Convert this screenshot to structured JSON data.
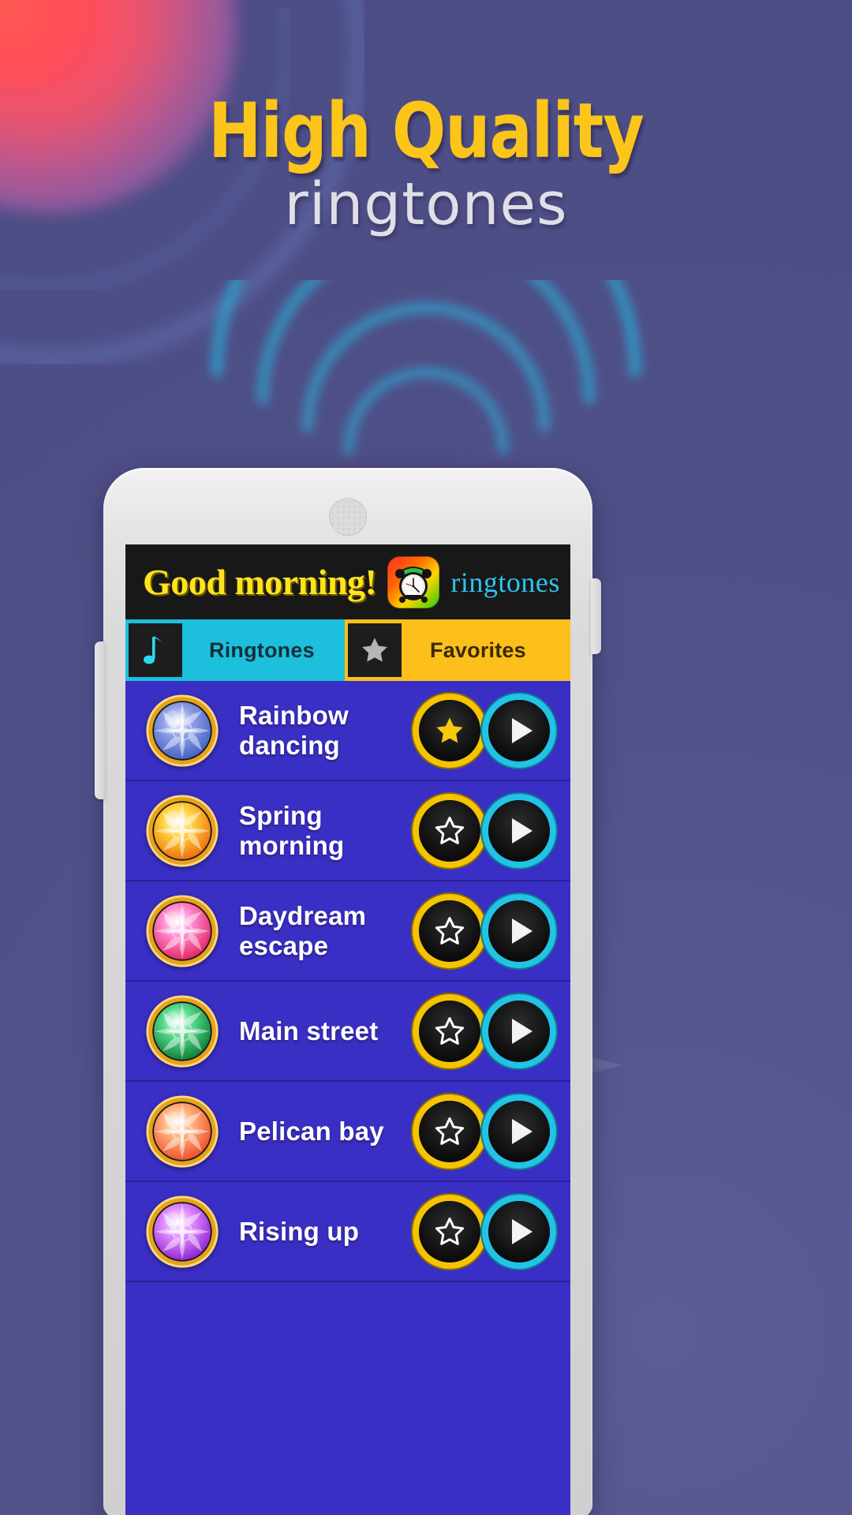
{
  "promo": {
    "headline": "High Quality",
    "subheadline": "ringtones",
    "headline_color": "#fcc51a",
    "subheadline_color": "#dfdfe6",
    "background_color": "#56568d",
    "accent_glow_color": "#ff4d4d",
    "arc_color": "#2f9fc9"
  },
  "app": {
    "banner": {
      "title": "Good morning!",
      "brand": "ringtones",
      "title_color": "#ffe31c",
      "brand_color": "#2fc3ef",
      "background_color": "#181818",
      "icon": "alarm-clock-icon"
    },
    "tabs": [
      {
        "label": "Ringtones",
        "icon": "music-note-icon",
        "active": true,
        "color": "#1cc0dd"
      },
      {
        "label": "Favorites",
        "icon": "star-icon",
        "active": false,
        "color": "#fcbf1b"
      }
    ],
    "list": {
      "row_color": "#3a2fc4",
      "favorite_button_ring": "#f5c400",
      "play_button_ring": "#22c3e4",
      "items": [
        {
          "title": "Rainbow dancing",
          "favorite": true,
          "thumb": "sun-icon-blue",
          "thumb_color": "#7f8fe0"
        },
        {
          "title": "Spring morning",
          "favorite": false,
          "thumb": "sun-icon-orange",
          "thumb_color": "#f7a21a"
        },
        {
          "title": "Daydream escape",
          "favorite": false,
          "thumb": "sun-icon-pink",
          "thumb_color": "#ef4aa0"
        },
        {
          "title": "Main street",
          "favorite": false,
          "thumb": "sun-icon-green",
          "thumb_color": "#1fa54d"
        },
        {
          "title": "Pelican bay",
          "favorite": false,
          "thumb": "sun-icon-coral",
          "thumb_color": "#f4633b"
        },
        {
          "title": "Rising up",
          "favorite": false,
          "thumb": "sun-icon-violet",
          "thumb_color": "#b03bd6"
        }
      ]
    }
  }
}
